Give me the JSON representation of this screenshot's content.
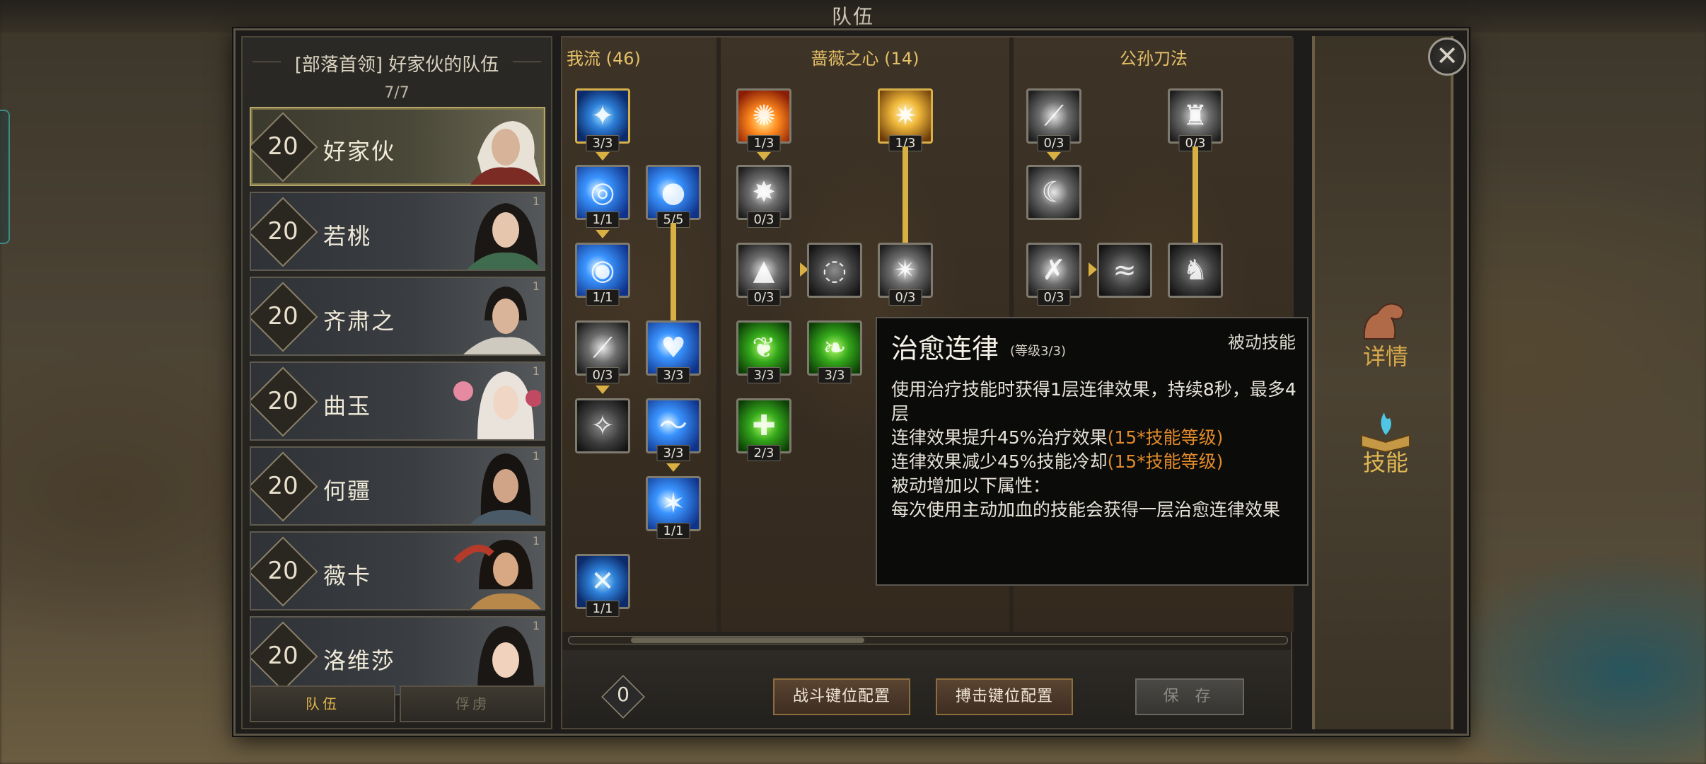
{
  "screen": {
    "title": "队伍"
  },
  "team": {
    "title": "[部落首领] 好家伙的队伍",
    "count": "7/7",
    "members": [
      {
        "level": "20",
        "name": "好家伙",
        "corner": ""
      },
      {
        "level": "20",
        "name": "若桃",
        "corner": "1"
      },
      {
        "level": "20",
        "name": "齐肃之",
        "corner": "1"
      },
      {
        "level": "20",
        "name": "曲玉",
        "corner": "1"
      },
      {
        "level": "20",
        "name": "何疆",
        "corner": "1"
      },
      {
        "level": "20",
        "name": "薇卡",
        "corner": "1"
      },
      {
        "level": "20",
        "name": "洛维莎",
        "corner": "1"
      }
    ],
    "tabs": {
      "team": "队伍",
      "captives": "俘虏"
    }
  },
  "trees": [
    {
      "name": "我流 (46)"
    },
    {
      "name": "蔷薇之心 (14)"
    },
    {
      "name": "公孙刀法"
    }
  ],
  "skills": {
    "t1": [
      "3/3",
      "1/1",
      "5/5",
      "1/1",
      "0/3",
      "3/3",
      "",
      "3/3",
      "1/1",
      "1/1"
    ],
    "t2": [
      "1/3",
      "1/3",
      "0/3",
      "0/3",
      "",
      "0/3",
      "3/3",
      "3/3",
      "2/3"
    ],
    "t3": [
      "0/3",
      "0/3",
      "",
      "0/3",
      "",
      ""
    ]
  },
  "bottom": {
    "points": "0",
    "battle_keys": "战斗键位配置",
    "grapple_keys": "搏击键位配置",
    "save": "保 存"
  },
  "sidebar": {
    "details": "详情",
    "skills": "技能"
  },
  "tooltip": {
    "title": "治愈连律",
    "level": "(等级3/3)",
    "type": "被动技能",
    "line1": "使用治疗技能时获得1层连律效果，持续8秒，最多4层",
    "line2a": "连律效果提升45%治疗效果",
    "line2b": "(15*技能等级)",
    "line3a": "连律效果减少45%技能冷却",
    "line3b": "(15*技能等级)",
    "line4": "被动增加以下属性：",
    "line5": "每次使用主动加血的技能会获得一层治愈连律效果"
  },
  "icons": {
    "close": "close-icon",
    "details": "arm-icon",
    "skills": "book-flame-icon"
  },
  "colors": {
    "accent_gold": "#d9b044",
    "highlight_orange": "#e08a2a",
    "tree_header": "#e4c067"
  }
}
